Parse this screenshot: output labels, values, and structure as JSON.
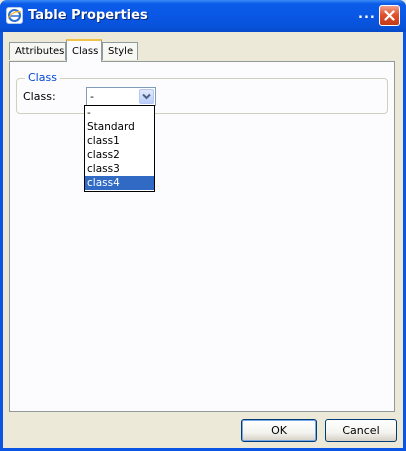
{
  "window": {
    "title": "Table Properties",
    "overflow_indicator": "...",
    "icons": [
      "browser-app-icon",
      "close-icon"
    ],
    "colors": {
      "titlebar": "#0a57e6",
      "close": "#e0522f",
      "legend": "#0046d5",
      "selection": "#316ac5"
    }
  },
  "tabs": [
    {
      "label": "Attributes",
      "active": false
    },
    {
      "label": "Class",
      "active": true
    },
    {
      "label": "Style",
      "active": false
    }
  ],
  "class_panel": {
    "legend": "Class",
    "field_label": "Class:",
    "selected_value": "-",
    "options": [
      "-",
      "Standard",
      "class1",
      "class2",
      "class3",
      "class4"
    ],
    "highlighted_option": "class4"
  },
  "buttons": {
    "ok": "OK",
    "cancel": "Cancel"
  }
}
